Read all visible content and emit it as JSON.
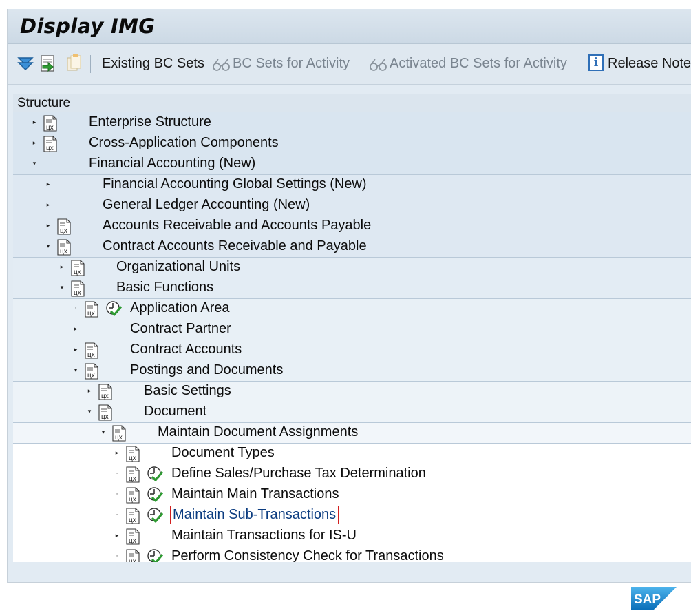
{
  "window": {
    "title": "Display IMG"
  },
  "toolbar": {
    "buttons": [
      {
        "icon": "filter-icon"
      },
      {
        "icon": "open-activity-icon"
      },
      {
        "icon": "copy-documentation-icon"
      }
    ],
    "existing_bc_sets": "Existing BC Sets",
    "bc_sets_for_activity": "BC Sets for Activity",
    "activated_bc_sets": "Activated BC Sets for Activity",
    "release_notes": "Release Notes",
    "info_icon_letter": "i"
  },
  "tree": {
    "header": "Structure",
    "items": [
      {
        "label": "Enterprise Structure"
      },
      {
        "label": "Cross-Application Components"
      },
      {
        "label": "Financial Accounting (New)"
      },
      {
        "label": "Financial Accounting Global Settings (New)"
      },
      {
        "label": "General Ledger Accounting (New)"
      },
      {
        "label": "Accounts Receivable and Accounts Payable"
      },
      {
        "label": "Contract Accounts Receivable and Payable"
      },
      {
        "label": "Organizational Units"
      },
      {
        "label": "Basic Functions"
      },
      {
        "label": "Application Area"
      },
      {
        "label": "Contract Partner"
      },
      {
        "label": "Contract Accounts"
      },
      {
        "label": "Postings and Documents"
      },
      {
        "label": "Basic Settings"
      },
      {
        "label": "Document"
      },
      {
        "label": "Maintain Document Assignments"
      },
      {
        "label": "Document Types"
      },
      {
        "label": "Define Sales/Purchase Tax Determination"
      },
      {
        "label": "Maintain Main Transactions"
      },
      {
        "label": "Maintain Sub-Transactions"
      },
      {
        "label": "Maintain Transactions for IS-U"
      },
      {
        "label": "Perform Consistency Check for Transactions"
      }
    ]
  },
  "branding": {
    "logo": "SAP"
  },
  "colors": {
    "link": "#0b3c80",
    "selection_border": "#d21f1f",
    "accent": "#2f6fb7"
  }
}
